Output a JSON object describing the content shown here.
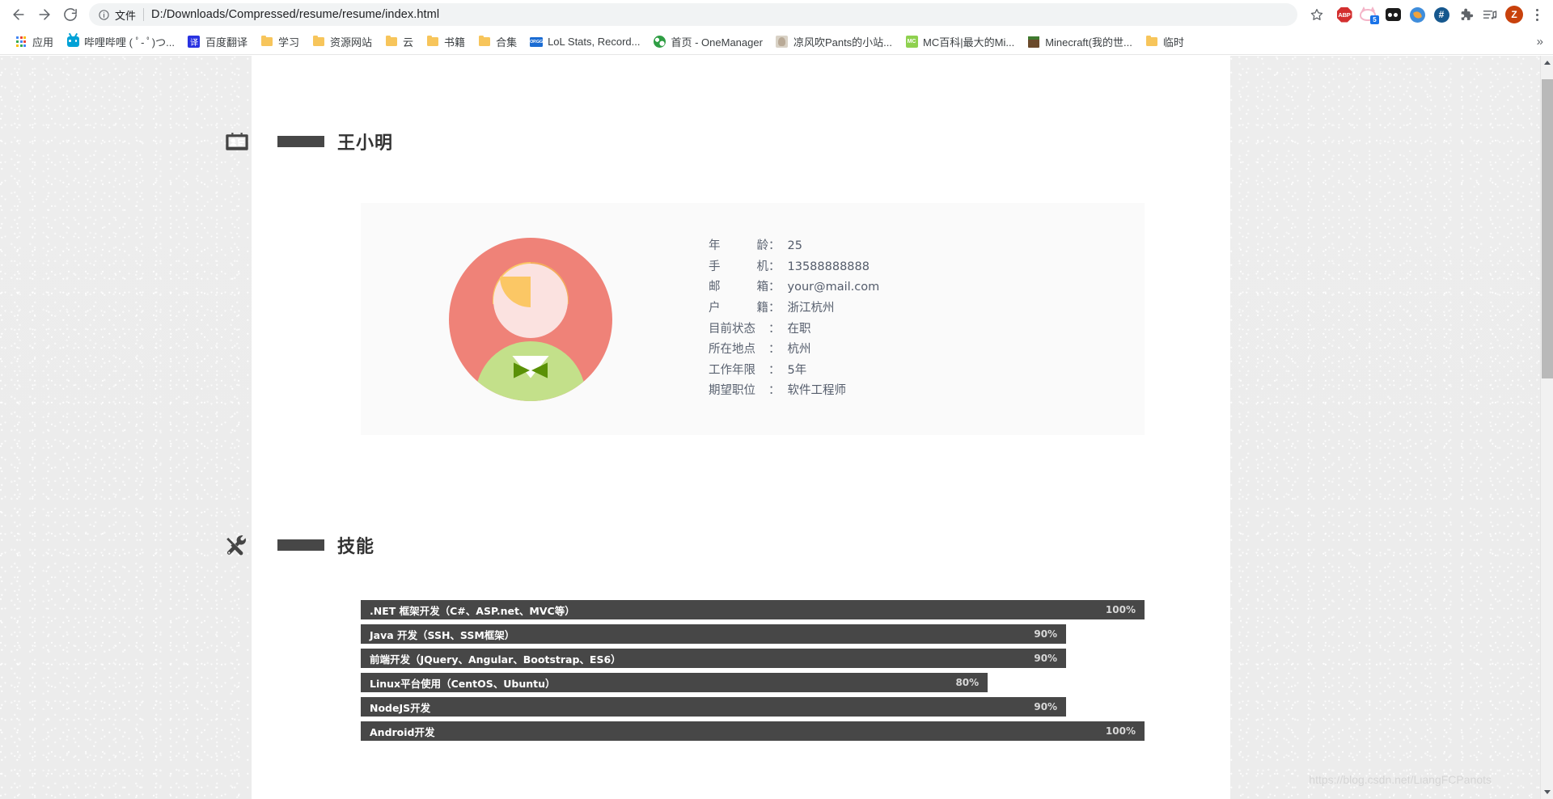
{
  "browser": {
    "nav": {
      "back": "back-arrow",
      "forward": "forward-arrow",
      "reload": "reload"
    },
    "omnibox": {
      "scheme_label": "文件",
      "url": "D:/Downloads/Compressed/resume/resume/index.html",
      "info_icon": "ⓘ"
    },
    "star_tooltip": "收藏",
    "extensions": [
      {
        "name": "adblock-plus",
        "label": "ABP"
      },
      {
        "name": "cat-extension",
        "label": "",
        "badge": "5"
      },
      {
        "name": "looking-glass-extension",
        "label": ""
      },
      {
        "name": "brush-extension",
        "label": ""
      },
      {
        "name": "hash-extension",
        "label": "#"
      },
      {
        "name": "puzzle-extensions-menu",
        "label": ""
      },
      {
        "name": "media-playlist",
        "label": ""
      }
    ],
    "profile_initial": "Z",
    "menu_icon": "kebab-menu"
  },
  "bookmarks": {
    "items": [
      {
        "label": "应用",
        "icon": "apps-grid-icon"
      },
      {
        "label": "哔哩哔哩 ( ﾟ- ﾟ)つ...",
        "icon": "bilibili-icon"
      },
      {
        "label": "百度翻译",
        "icon": "baidu-fanyi-icon"
      },
      {
        "label": "学习",
        "icon": "folder-icon"
      },
      {
        "label": "资源网站",
        "icon": "folder-icon"
      },
      {
        "label": "云",
        "icon": "folder-icon"
      },
      {
        "label": "书籍",
        "icon": "folder-icon"
      },
      {
        "label": "合集",
        "icon": "folder-icon"
      },
      {
        "label": "LoL Stats, Record...",
        "icon": "opgg-icon"
      },
      {
        "label": "首页 - OneManager",
        "icon": "globe-icon"
      },
      {
        "label": "凉风吹Pants的小站...",
        "icon": "pants-site-icon"
      },
      {
        "label": "MC百科|最大的Mi...",
        "icon": "mcmod-icon"
      },
      {
        "label": "Minecraft(我的世...",
        "icon": "minecraft-icon"
      },
      {
        "label": "临时",
        "icon": "folder-icon"
      }
    ],
    "overflow_label": "»"
  },
  "page": {
    "basic_section": {
      "icon": "id-card-icon",
      "title": "王小明"
    },
    "info": {
      "avatar_alt": "avatar-illustration",
      "rows": [
        {
          "label": "年 龄",
          "label_left": "年",
          "label_right": "龄",
          "value": "25"
        },
        {
          "label": "手 机",
          "label_left": "手",
          "label_right": "机",
          "value": "13588888888"
        },
        {
          "label": "邮 箱",
          "label_left": "邮",
          "label_right": "箱",
          "value": "your@mail.com"
        },
        {
          "label": "户 籍",
          "label_left": "户",
          "label_right": "籍",
          "value": "浙江杭州"
        },
        {
          "label": "目前状态",
          "label_left": "目前状态",
          "label_right": "",
          "value": "在职"
        },
        {
          "label": "所在地点",
          "label_left": "所在地点",
          "label_right": "",
          "value": "杭州"
        },
        {
          "label": "工作年限",
          "label_left": "工作年限",
          "label_right": "",
          "value": "5年"
        },
        {
          "label": "期望职位",
          "label_left": "期望职位",
          "label_right": "",
          "value": "软件工程师"
        }
      ],
      "colon": "："
    },
    "skills_section": {
      "icon": "tools-icon",
      "title": "技能",
      "items": [
        {
          "name": ".NET 框架开发（C#、ASP.net、MVC等）",
          "percent": 100,
          "percent_label": "100%"
        },
        {
          "name": "Java 开发（SSH、SSM框架）",
          "percent": 90,
          "percent_label": "90%"
        },
        {
          "name": "前端开发（JQuery、Angular、Bootstrap、ES6）",
          "percent": 90,
          "percent_label": "90%"
        },
        {
          "name": "Linux平台使用（CentOS、Ubuntu）",
          "percent": 80,
          "percent_label": "80%"
        },
        {
          "name": "NodeJS开发",
          "percent": 90,
          "percent_label": "90%"
        },
        {
          "name": "Android开发",
          "percent": 100,
          "percent_label": "100%"
        }
      ]
    },
    "watermark": "https://blog.csdn.net/LiangFCPanots"
  },
  "colors": {
    "bar_dark": "#474747",
    "avatar_circle": "#ef8278",
    "avatar_hair": "#fbc765",
    "avatar_shirt": "#c3e08a",
    "accent_blue": "#1a73e8"
  }
}
